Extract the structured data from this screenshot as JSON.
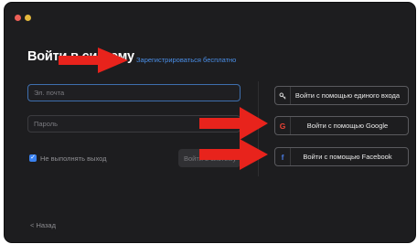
{
  "window": {
    "title": "Войти в систему"
  },
  "signup": {
    "label": "Зарегистрироваться бесплатно"
  },
  "form": {
    "email_placeholder": "Эл. почта",
    "password_placeholder": "Пароль",
    "keep_signed_in_label": "Не выполнять выход",
    "keep_signed_in_checked": true,
    "signin_button": "Войти в систему"
  },
  "sso": {
    "sso_label": "Войти с помощью единого входа",
    "google_label": "Войти с помощью Google",
    "facebook_label": "Войти с помощью Facebook"
  },
  "footer": {
    "back_label": "Назад",
    "back_chevron": "<"
  },
  "icons": {
    "sso_icon": "key-icon",
    "google_icon": "google-icon",
    "facebook_icon": "facebook-icon"
  },
  "colors": {
    "accent": "#4a8fe8",
    "window_bg": "#1d1d1f",
    "annotation_arrow": "#e8231c"
  }
}
